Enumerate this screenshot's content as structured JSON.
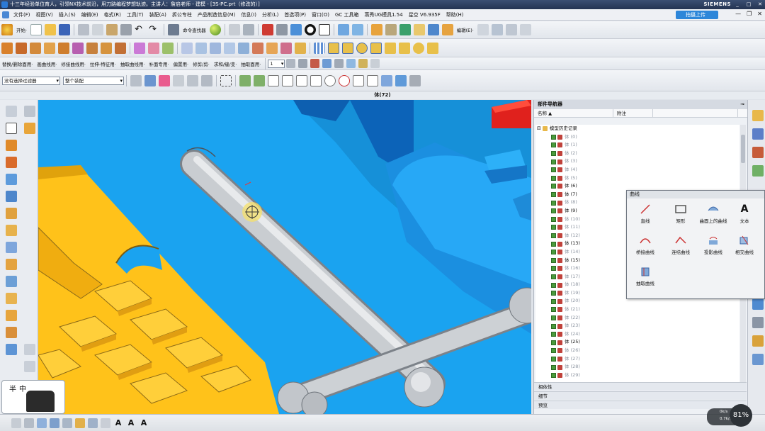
{
  "titlebar": {
    "title": "十三年经验单位育人，引领NX技术前沿，用刀路编程梦想轨迹。主讲人：詹启老师 - 建模 - [3S-PC.prt（修改的）]",
    "brand": "SIEMENS"
  },
  "menubar": {
    "items": [
      "文件(F)",
      "视图(V)",
      "插入(S)",
      "编辑(E)",
      "格式(R)",
      "工具(T)",
      "装配(A)",
      "拆公专柱",
      "产品制造信息(M)",
      "信息(I)",
      "分析(L)",
      "首选项(P)",
      "窗口(O)",
      "GC 工具箱",
      "燕秀UG模具1.54",
      "星空 V6.935F",
      "帮助(H)"
    ],
    "upload_label": "拍摄上传",
    "win_controls": [
      "—",
      "❐",
      "✕"
    ]
  },
  "toolbar1": {
    "start_label": "开始·",
    "cmd_finder_label": "命令查找器",
    "edit_label": "编辑(E)·"
  },
  "toolbar3": {
    "items": [
      "替换/删除面用·",
      "画曲线用·",
      "修接曲线用·",
      "拉伸-特征用·",
      "抽取曲线用·",
      "补面专用·",
      "偏置用·",
      "修剪/剪·",
      "求和/缝/变·",
      "抽取面用·"
    ],
    "layer_value": "1"
  },
  "toolbar4": {
    "filter_value": "没有选择过滤器",
    "assembly_value": "整个装配"
  },
  "statusline": {
    "text": "体(72)"
  },
  "navigator": {
    "title": "部件导航器",
    "col_name": "名称",
    "col_attach": "附注",
    "root": "模型历史记录",
    "rows": [
      {
        "label": "体 (0)",
        "dim": true
      },
      {
        "label": "体 (1)",
        "dim": true
      },
      {
        "label": "体 (2)",
        "dim": true
      },
      {
        "label": "体 (3)",
        "dim": true
      },
      {
        "label": "体 (4)",
        "dim": true
      },
      {
        "label": "体 (5)",
        "dim": true
      },
      {
        "label": "体 (6)",
        "dim": false
      },
      {
        "label": "体 (7)",
        "dim": false
      },
      {
        "label": "体 (8)",
        "dim": true
      },
      {
        "label": "体 (9)",
        "dim": false
      },
      {
        "label": "体 (10)",
        "dim": true
      },
      {
        "label": "体 (11)",
        "dim": true
      },
      {
        "label": "体 (12)",
        "dim": true
      },
      {
        "label": "体 (13)",
        "dim": false
      },
      {
        "label": "体 (14)",
        "dim": true
      },
      {
        "label": "体 (15)",
        "dim": false
      },
      {
        "label": "体 (16)",
        "dim": true
      },
      {
        "label": "体 (17)",
        "dim": true
      },
      {
        "label": "体 (18)",
        "dim": true
      },
      {
        "label": "体 (19)",
        "dim": true
      },
      {
        "label": "体 (20)",
        "dim": true
      },
      {
        "label": "体 (21)",
        "dim": true
      },
      {
        "label": "体 (22)",
        "dim": true
      },
      {
        "label": "体 (23)",
        "dim": true
      },
      {
        "label": "体 (24)",
        "dim": true
      },
      {
        "label": "体 (25)",
        "dim": false
      },
      {
        "label": "体 (26)",
        "dim": true
      },
      {
        "label": "体 (27)",
        "dim": true
      },
      {
        "label": "体 (28)",
        "dim": true
      },
      {
        "label": "体 (29)",
        "dim": true
      }
    ],
    "footers": [
      "相依性",
      "细节",
      "预览"
    ]
  },
  "curve_panel": {
    "title": "曲线",
    "items": [
      "直线",
      "矩形",
      "曲面上的曲线",
      "文本",
      "桥接曲线",
      "连结曲线",
      "投影曲线",
      "相交曲线",
      "抽取曲线"
    ]
  },
  "ime": {
    "text": "半中"
  },
  "meter": {
    "percent": "81%",
    "up": "0k/s",
    "down": "0.7k/s"
  },
  "colors": {
    "viewport_bg": "#1aa3f0",
    "part_yellow": "#ffc21a",
    "handle_gray": "#cfd3d7",
    "accent_red": "#e0211d"
  }
}
